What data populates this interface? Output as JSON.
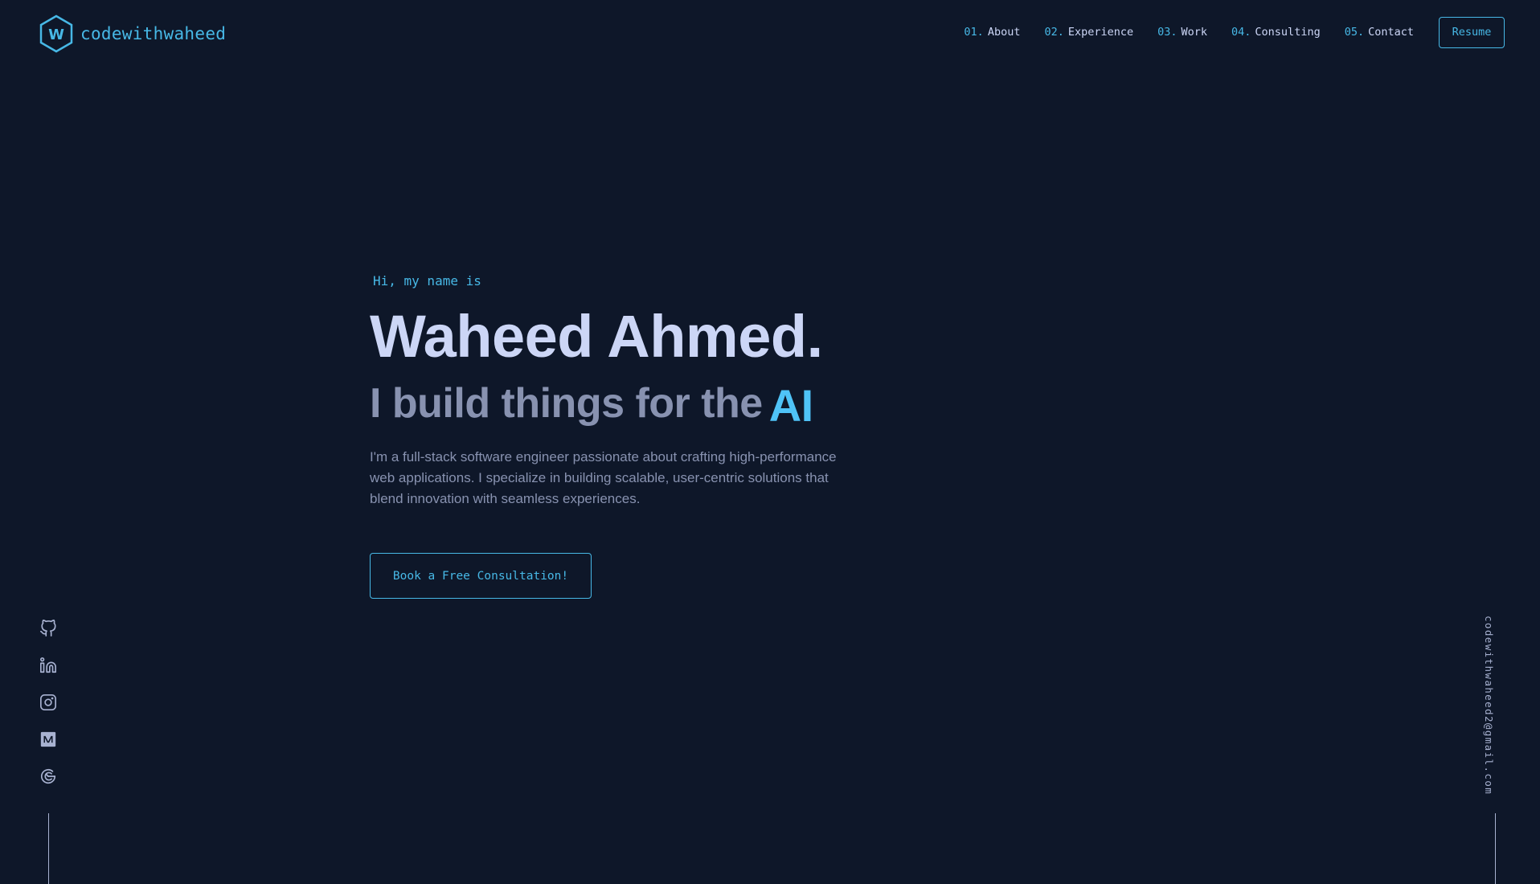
{
  "brand": {
    "logo_letter": "W",
    "name": "codewithwaheed",
    "accent_color": "#47b8e6",
    "background_color": "#0e1729"
  },
  "nav": {
    "items": [
      {
        "num": "01.",
        "label": "About"
      },
      {
        "num": "02.",
        "label": "Experience"
      },
      {
        "num": "03.",
        "label": "Work"
      },
      {
        "num": "04.",
        "label": "Consulting"
      },
      {
        "num": "05.",
        "label": "Contact"
      }
    ],
    "resume_label": "Resume"
  },
  "hero": {
    "greeting": "Hi, my name is",
    "name": "Waheed Ahmed.",
    "tagline_prefix": "I build things for the",
    "tagline_accent": "AI",
    "bio": "I'm a full-stack software engineer passionate about crafting high-performance web applications. I specialize in building scalable, user-centric solutions that blend innovation with seamless experiences.",
    "cta_label": "Book a Free Consultation!"
  },
  "social": {
    "icons": [
      "github-icon",
      "linkedin-icon",
      "instagram-icon",
      "medium-icon",
      "codepen-icon"
    ]
  },
  "email": "codewithwaheed2@gmail.com"
}
